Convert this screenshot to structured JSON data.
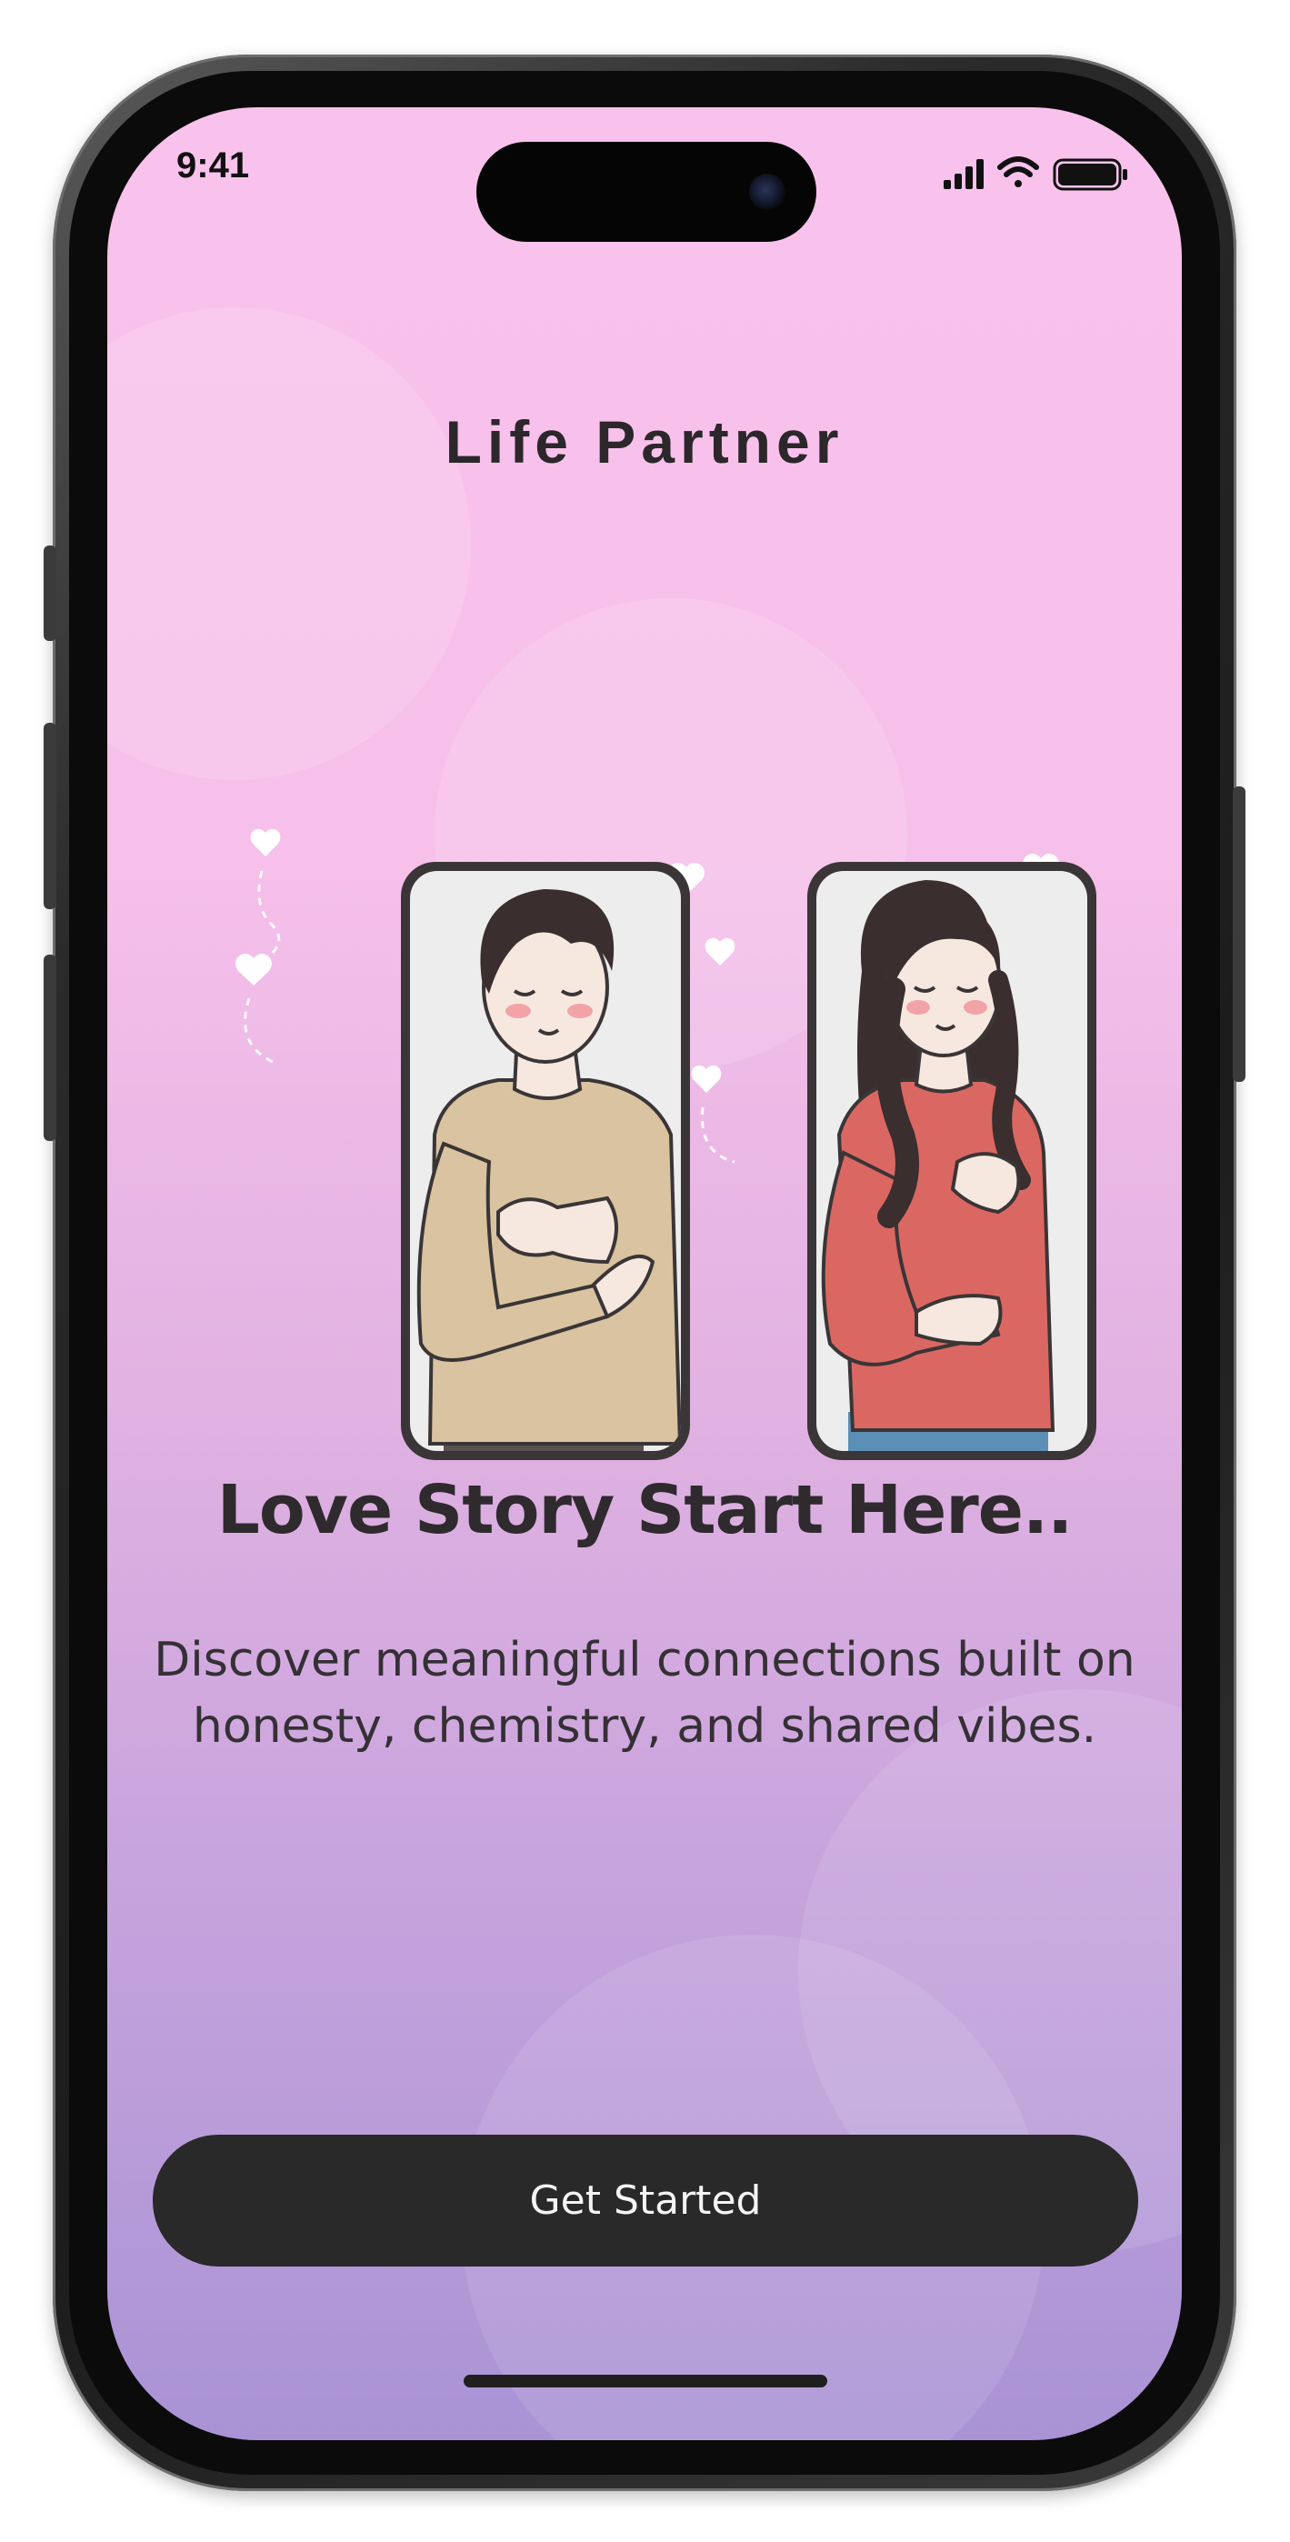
{
  "status_bar": {
    "time": "9:41",
    "icons": [
      "cellular-signal-icon",
      "wifi-icon",
      "battery-icon"
    ]
  },
  "app": {
    "title": "Life Partner"
  },
  "hero": {
    "illustration": "couple-illustration",
    "headline": "Love Story Start Here..",
    "description": "Discover meaningful connections built on honesty, chemistry, and shared vibes."
  },
  "actions": {
    "get_started_label": "Get Started"
  },
  "colors": {
    "background_top": "#f9c2ec",
    "background_bottom": "#a993d5",
    "button": "#292929",
    "button_text": "#f4f4f4",
    "text_dark": "#2f2a2e"
  }
}
